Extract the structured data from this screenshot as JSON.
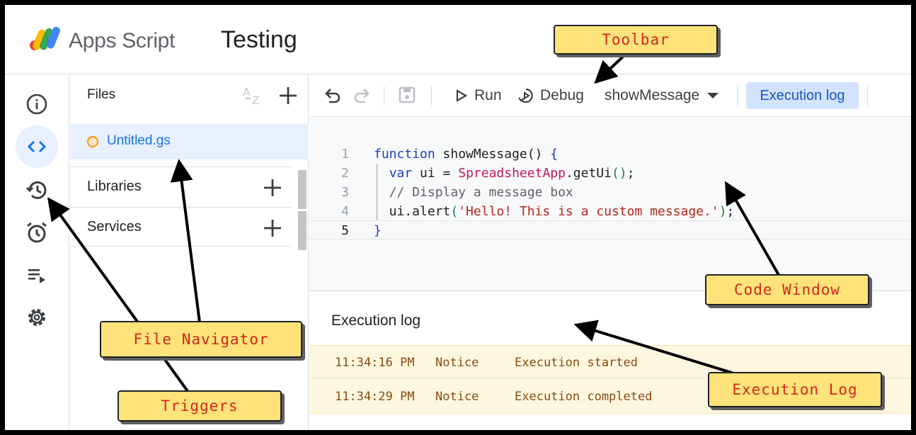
{
  "header": {
    "product": "Apps Script",
    "project": "Testing"
  },
  "files_panel": {
    "title": "Files",
    "file_name": "Untitled.gs",
    "sections": [
      "Libraries",
      "Services"
    ]
  },
  "toolbar": {
    "run_label": "Run",
    "debug_label": "Debug",
    "function_selector": "showMessage",
    "execution_log_button": "Execution log"
  },
  "editor": {
    "line_numbers": [
      "1",
      "2",
      "3",
      "4",
      "5"
    ],
    "lines": [
      [
        {
          "t": "function",
          "c": "kw"
        },
        {
          "t": " showMessage() ",
          "c": ""
        },
        {
          "t": "{",
          "c": "kw"
        }
      ],
      [
        {
          "t": "  ",
          "c": ""
        },
        {
          "t": "var",
          "c": "kw"
        },
        {
          "t": " ui = ",
          "c": ""
        },
        {
          "t": "SpreadsheetApp",
          "c": "cls"
        },
        {
          "t": ".getUi",
          "c": ""
        },
        {
          "t": "()",
          "c": "br"
        },
        {
          "t": ";",
          "c": ""
        }
      ],
      [
        {
          "t": "  // Display a message box",
          "c": "cmt"
        }
      ],
      [
        {
          "t": "  ui.alert",
          "c": ""
        },
        {
          "t": "(",
          "c": "br"
        },
        {
          "t": "'Hello! This is a custom message.'",
          "c": "str"
        },
        {
          "t": ")",
          "c": "br"
        },
        {
          "t": ";",
          "c": ""
        }
      ],
      [
        {
          "t": "}",
          "c": "kw"
        }
      ]
    ]
  },
  "execution_log": {
    "title": "Execution log",
    "rows": [
      {
        "time": "11:34:16 PM",
        "level": "Notice",
        "message": "Execution started"
      },
      {
        "time": "11:34:29 PM",
        "level": "Notice",
        "message": "Execution completed"
      }
    ]
  },
  "annotations": {
    "toolbar": "Toolbar",
    "file_navigator": "File Navigator",
    "triggers": "Triggers",
    "code_window": "Code Window",
    "execution_log": "Execution Log"
  },
  "colors": {
    "accent": "#1a73e8",
    "callout_fill": "#fde37a",
    "callout_text": "#d4261c",
    "log_row": "#fef7e0"
  }
}
